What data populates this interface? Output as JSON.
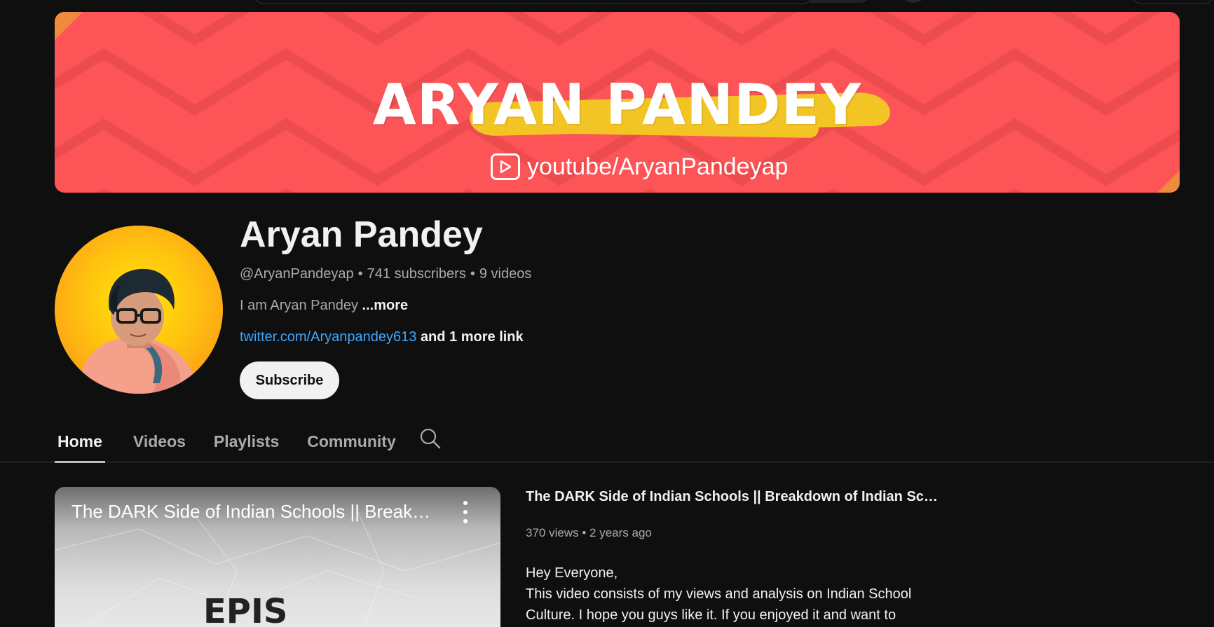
{
  "banner": {
    "title": "ARYAN PANDEY",
    "link_text": "youtube/AryanPandeyap",
    "colors": {
      "background": "#fc5457",
      "brush": "#f3c524",
      "corner": "#f08a3c"
    }
  },
  "channel": {
    "name": "Aryan Pandey",
    "handle": "@AryanPandeyap",
    "subscribers": "741 subscribers",
    "videos": "9 videos",
    "separator": "•",
    "description": "I am Aryan Pandey",
    "more_label": "...more",
    "link_url_text": "twitter.com/Aryanpandey613",
    "link_more_text": "and 1 more link",
    "subscribe_label": "Subscribe"
  },
  "tabs": [
    {
      "label": "Home",
      "active": true
    },
    {
      "label": "Videos",
      "active": false
    },
    {
      "label": "Playlists",
      "active": false
    },
    {
      "label": "Community",
      "active": false
    }
  ],
  "featured_video": {
    "thumb_title": "The DARK Side of Indian Schools || Breakd...",
    "thumb_text": "EPIS",
    "title": "The DARK Side of Indian Schools || Breakdown of Indian Scho...",
    "views": "370 views",
    "age": "2 years ago",
    "separator": "•",
    "description_line1": "Hey Everyone,",
    "description_line2": "This video consists of my views and analysis on Indian School",
    "description_line3": "Culture. I hope you guys like it. If you enjoyed it and want to"
  },
  "icons": {
    "tab_search": "search-icon",
    "banner_play": "play-icon",
    "video_menu": "more-vert-icon"
  },
  "theme": {
    "accent_link": "#3ea6ff",
    "background": "#0f0f0f",
    "text": "#f1f1f1",
    "muted": "#aaaaaa"
  }
}
